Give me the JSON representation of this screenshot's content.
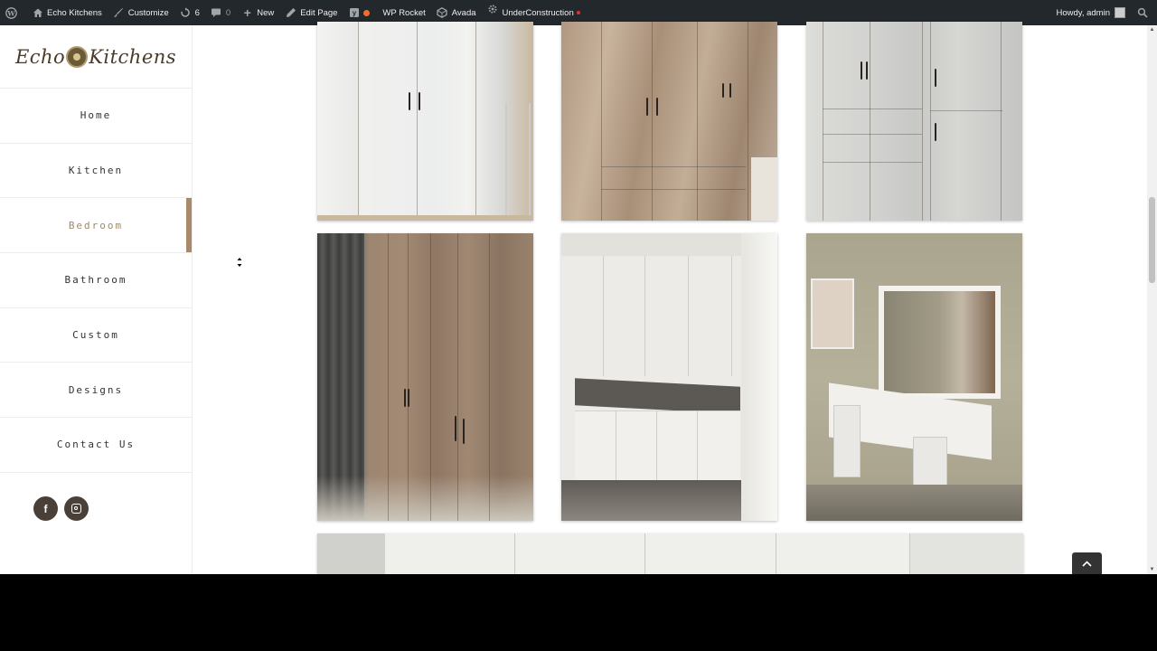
{
  "adminbar": {
    "site_name": "Echo Kitchens",
    "customize": "Customize",
    "updates_count": "6",
    "comments_count": "0",
    "new_label": "New",
    "edit_page": "Edit Page",
    "wp_rocket": "WP Rocket",
    "avada": "Avada",
    "under_construction": "UnderConstruction",
    "howdy": "Howdy, admin"
  },
  "logo": {
    "left": "Echo",
    "right": "Kitchens"
  },
  "nav": {
    "items": [
      {
        "label": "Home"
      },
      {
        "label": "Kitchen"
      },
      {
        "label": "Bedroom"
      },
      {
        "label": "Bathroom"
      },
      {
        "label": "Custom"
      },
      {
        "label": "Designs"
      },
      {
        "label": "Contact Us"
      }
    ],
    "active": "Bedroom"
  },
  "social": {
    "facebook_glyph": "f"
  },
  "colors": {
    "accent": "#a8896a",
    "adminbar": "#23282d"
  },
  "icons": [
    "wordpress-icon",
    "home-icon",
    "brush-icon",
    "refresh-icon",
    "comment-icon",
    "plus-icon",
    "pencil-icon",
    "yoast-icon",
    "avada-icon",
    "gear-icon",
    "search-icon",
    "facebook-icon",
    "instagram-icon",
    "chevron-up-icon"
  ]
}
